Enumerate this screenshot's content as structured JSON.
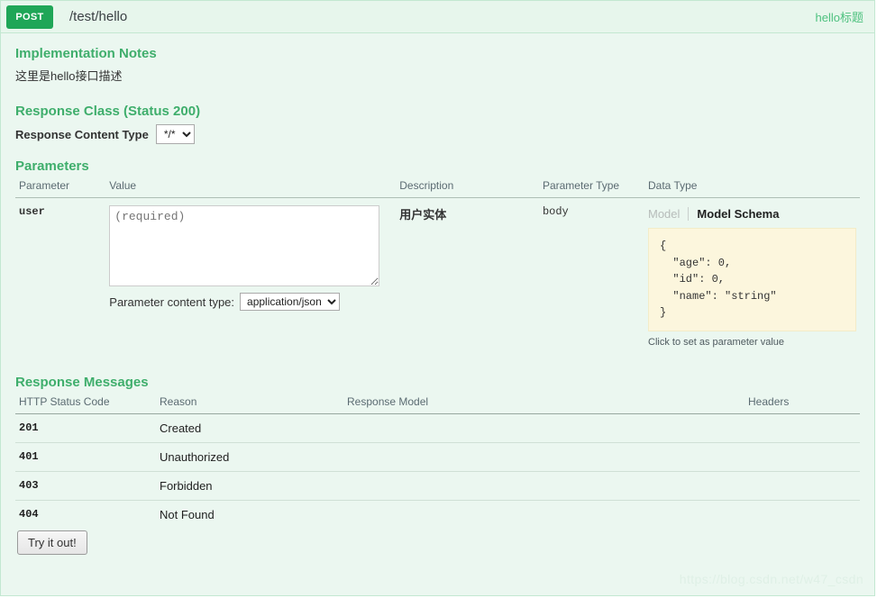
{
  "operation": {
    "method": "POST",
    "path": "/test/hello",
    "summary": "hello标题"
  },
  "notes": {
    "heading": "Implementation Notes",
    "text": "这里是hello接口描述"
  },
  "response_class": {
    "heading": "Response Class (Status 200)",
    "content_type_label": "Response Content Type",
    "content_type_value": "*/*",
    "content_type_options": [
      "*/*"
    ]
  },
  "parameters": {
    "heading": "Parameters",
    "columns": [
      "Parameter",
      "Value",
      "Description",
      "Parameter Type",
      "Data Type"
    ],
    "rows": [
      {
        "name": "user",
        "value_placeholder": "(required)",
        "value": "",
        "description": "用户实体",
        "parameter_type": "body",
        "content_type_label": "Parameter content type:",
        "content_type_value": "application/json",
        "content_type_options": [
          "application/json"
        ],
        "data_type": {
          "tab_model": "Model",
          "tab_model_schema": "Model Schema",
          "schema": "{\n  \"age\": 0,\n  \"id\": 0,\n  \"name\": \"string\"\n}",
          "hint": "Click to set as parameter value"
        }
      }
    ]
  },
  "response_messages": {
    "heading": "Response Messages",
    "columns": [
      "HTTP Status Code",
      "Reason",
      "Response Model",
      "Headers"
    ],
    "rows": [
      {
        "code": "201",
        "reason": "Created",
        "model": "",
        "headers": ""
      },
      {
        "code": "401",
        "reason": "Unauthorized",
        "model": "",
        "headers": ""
      },
      {
        "code": "403",
        "reason": "Forbidden",
        "model": "",
        "headers": ""
      },
      {
        "code": "404",
        "reason": "Not Found",
        "model": "",
        "headers": ""
      }
    ]
  },
  "actions": {
    "submit_label": "Try it out!"
  },
  "watermark": "https://blog.csdn.net/w47_csdn",
  "colors": {
    "method_badge": "#1fa657",
    "accent_green": "#3fae6c",
    "panel_bg": "#ebf7f0",
    "schema_bg": "#fcf6dd"
  }
}
